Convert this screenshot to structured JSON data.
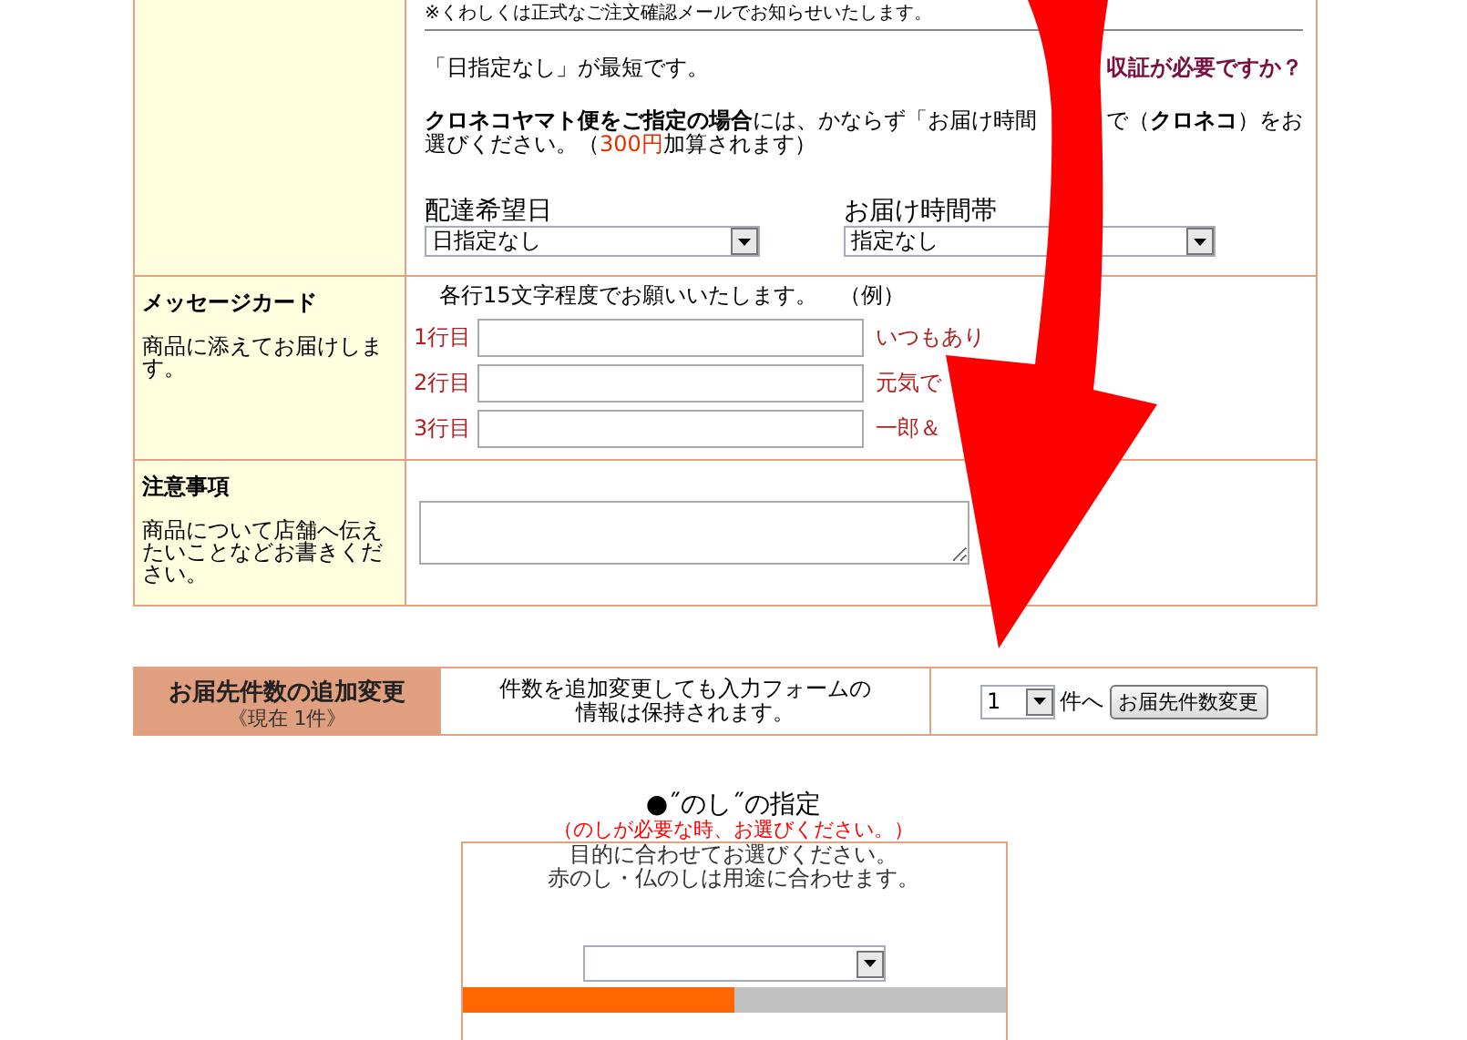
{
  "delivery": {
    "notice": "※くわしくは正式なご注文確認メールでお知らせいたします。",
    "shortest_note": "「日指定なし」が最短です。",
    "receipt_link": "収証が必要ですか？",
    "yamato_lines": [
      [
        {
          "text": "クロネコヤマト便をご指定の場合",
          "kind": "bold"
        },
        {
          "text": "には、かならず「お届け時間",
          "kind": "plain"
        }
      ],
      [
        {
          "text": "で（",
          "kind": "plain"
        },
        {
          "text": "クロネコ",
          "kind": "bold"
        },
        {
          "text": "）をお",
          "kind": "plain"
        }
      ],
      [
        {
          "text": "選びください。（",
          "kind": "plain"
        },
        {
          "text": "300円",
          "kind": "accent"
        },
        {
          "text": "加算されます）",
          "kind": "plain"
        }
      ]
    ],
    "date": {
      "label": "配達希望日",
      "value": "日指定なし"
    },
    "time": {
      "label": "お届け時間帯",
      "value": "指定なし"
    }
  },
  "message_card": {
    "title": "メッセージカード",
    "description": "商品に添えてお届けします。",
    "hint": "各行15文字程度でお願いいたします。　（例）",
    "lines": [
      {
        "label": "1行目",
        "example": "いつもあり"
      },
      {
        "label": "2行目",
        "example": "元気で"
      },
      {
        "label": "3行目",
        "example": "一郎＆"
      }
    ]
  },
  "notes": {
    "title": "注意事項",
    "description": "商品について店舗へ伝えたいことなどお書きください。"
  },
  "destination_count": {
    "title": "お届先件数の追加変更",
    "current": "《現在 1件》",
    "info": "件数を追加変更しても入力フォームの情報は保持されます。",
    "count": "1",
    "unit": "件へ",
    "button": "お届先件数変更"
  },
  "noshi": {
    "title": "●˝のし˝の指定",
    "subtitle": "（のしが必要な時、お選びください。）",
    "description": [
      "目的に合わせてお選びください。",
      "赤のし・仏のしは用途に合わせます。"
    ],
    "tabs": [
      {
        "selected": true
      },
      {
        "selected": false
      }
    ]
  }
}
